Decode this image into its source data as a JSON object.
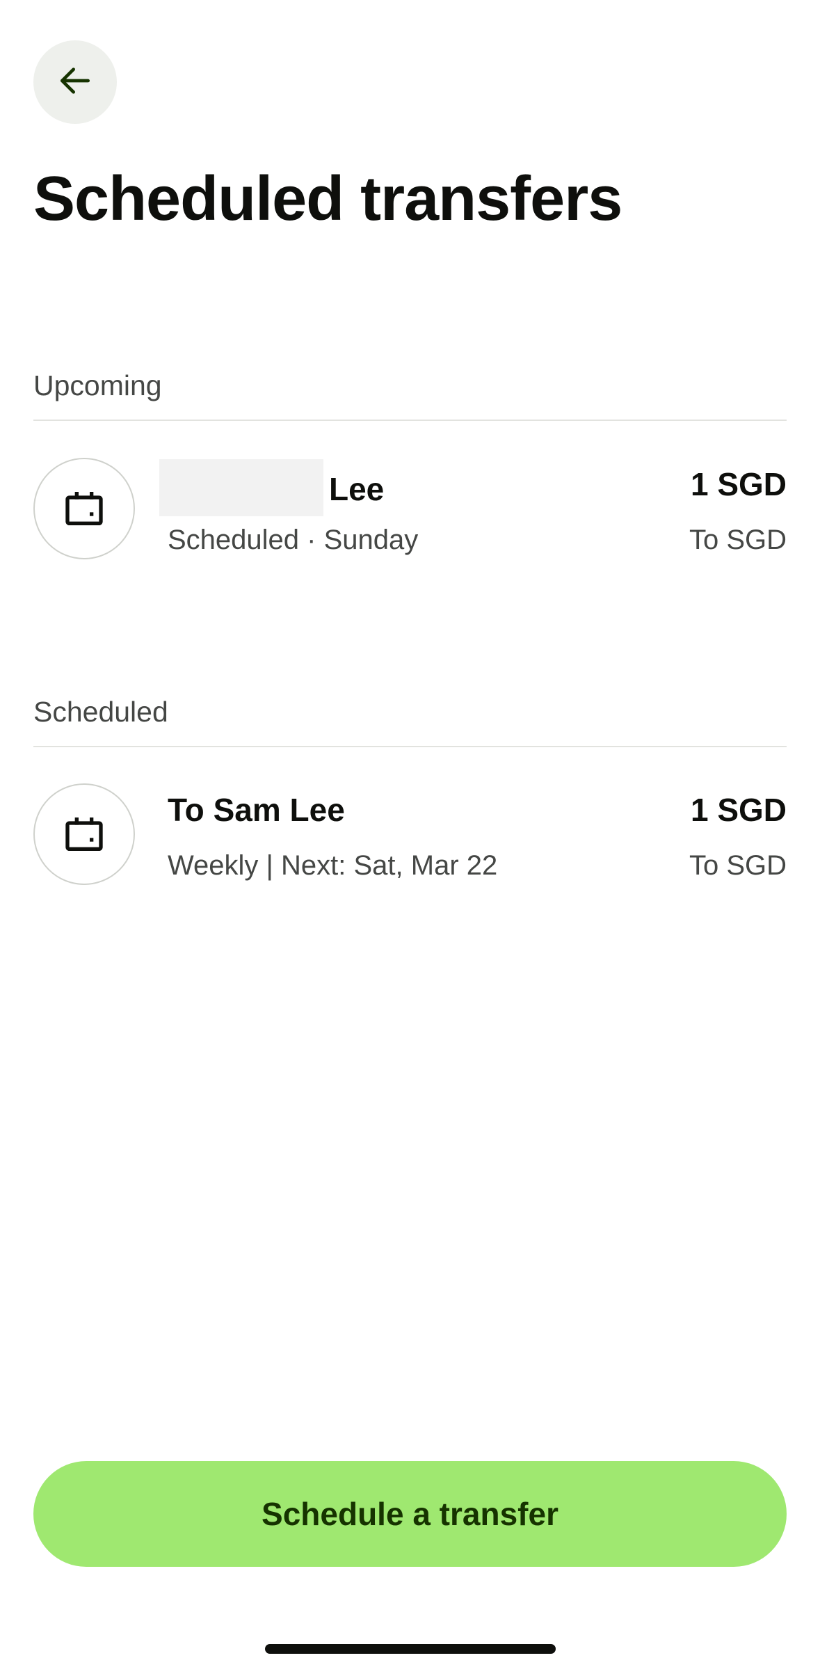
{
  "header": {
    "back_icon": "arrow-left-icon",
    "title": "Scheduled transfers"
  },
  "sections": {
    "upcoming": {
      "label": "Upcoming",
      "item": {
        "icon": "calendar-icon",
        "title": "Lee",
        "subtitle": "Scheduled · Sunday",
        "amount": "1 SGD",
        "currency": "To SGD"
      }
    },
    "scheduled": {
      "label": "Scheduled",
      "item": {
        "icon": "calendar-icon",
        "title": "To Sam Lee",
        "subtitle": "Weekly | Next: Sat, Mar 22",
        "amount": "1 SGD",
        "currency": "To SGD"
      }
    }
  },
  "actions": {
    "schedule_label": "Schedule a transfer"
  },
  "colors": {
    "accent": "#9fe870",
    "accent_text": "#163300",
    "back_bg": "#eef0ec",
    "secondary_text": "#454745"
  }
}
